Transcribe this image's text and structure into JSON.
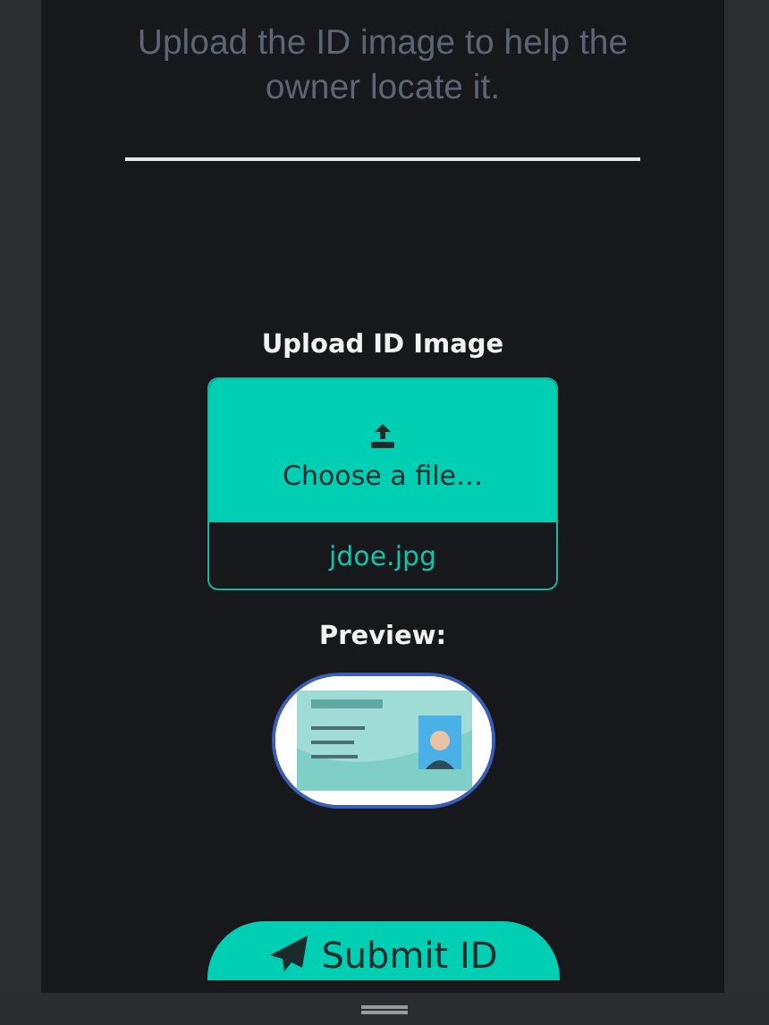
{
  "intro": "Upload the ID image to help the owner locate it.",
  "upload": {
    "label": "Upload ID Image",
    "button": "Choose a file…",
    "file_name": "jdoe.jpg"
  },
  "preview": {
    "label": "Preview:"
  },
  "submit": {
    "label": "Submit ID"
  }
}
